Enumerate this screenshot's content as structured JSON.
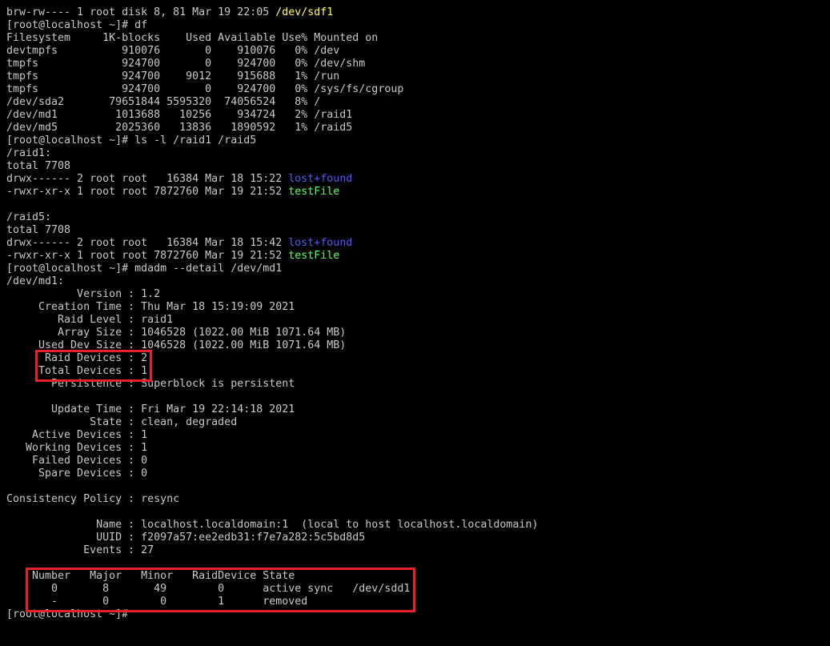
{
  "terminal": {
    "prompt": "[root@localhost ~]#",
    "lines": [
      {
        "text": "brw-rw---- 1 root disk 8, 81 Mar 19 22:05 ",
        "hl": "/dev/sdf1",
        "hl_color": "yellow"
      },
      {
        "text": "[root@localhost ~]# df"
      },
      {
        "text": "Filesystem     1K-blocks    Used Available Use% Mounted on"
      },
      {
        "text": "devtmpfs          910076       0    910076   0% /dev"
      },
      {
        "text": "tmpfs             924700       0    924700   0% /dev/shm"
      },
      {
        "text": "tmpfs             924700    9012    915688   1% /run"
      },
      {
        "text": "tmpfs             924700       0    924700   0% /sys/fs/cgroup"
      },
      {
        "text": "/dev/sda2       79651844 5595320  74056524   8% /"
      },
      {
        "text": "/dev/md1         1013688   10256    934724   2% /raid1"
      },
      {
        "text": "/dev/md5         2025360   13836   1890592   1% /raid5"
      },
      {
        "text": "[root@localhost ~]# ls -l /raid1 /raid5"
      },
      {
        "text": "/raid1:"
      },
      {
        "text": "total 7708"
      },
      {
        "text": "drwx------ 2 root root   16384 Mar 18 15:22 ",
        "hl": "lost+found",
        "hl_color": "blue"
      },
      {
        "text": "-rwxr-xr-x 1 root root 7872760 Mar 19 21:52 ",
        "hl": "testFile",
        "hl_color": "green"
      },
      {
        "text": ""
      },
      {
        "text": "/raid5:"
      },
      {
        "text": "total 7708"
      },
      {
        "text": "drwx------ 2 root root   16384 Mar 18 15:42 ",
        "hl": "lost+found",
        "hl_color": "blue"
      },
      {
        "text": "-rwxr-xr-x 1 root root 7872760 Mar 19 21:52 ",
        "hl": "testFile",
        "hl_color": "green"
      },
      {
        "text": "[root@localhost ~]# mdadm --detail /dev/md1"
      },
      {
        "text": "/dev/md1:"
      },
      {
        "text": "           Version : 1.2"
      },
      {
        "text": "     Creation Time : Thu Mar 18 15:19:09 2021"
      },
      {
        "text": "        Raid Level : raid1"
      },
      {
        "text": "        Array Size : 1046528 (1022.00 MiB 1071.64 MB)"
      },
      {
        "text": "     Used Dev Size : 1046528 (1022.00 MiB 1071.64 MB)"
      },
      {
        "text": "      Raid Devices : 2"
      },
      {
        "text": "     Total Devices : 1"
      },
      {
        "text": "       Persistence : Superblock is persistent"
      },
      {
        "text": ""
      },
      {
        "text": "       Update Time : Fri Mar 19 22:14:18 2021"
      },
      {
        "text": "             State : clean, degraded"
      },
      {
        "text": "    Active Devices : 1"
      },
      {
        "text": "   Working Devices : 1"
      },
      {
        "text": "    Failed Devices : 0"
      },
      {
        "text": "     Spare Devices : 0"
      },
      {
        "text": ""
      },
      {
        "text": "Consistency Policy : resync"
      },
      {
        "text": ""
      },
      {
        "text": "              Name : localhost.localdomain:1  (local to host localhost.localdomain)"
      },
      {
        "text": "              UUID : f2097a57:ee2edb31:f7e7a282:5c5bd8d5"
      },
      {
        "text": "            Events : 27"
      },
      {
        "text": ""
      },
      {
        "text": "    Number   Major   Minor   RaidDevice State"
      },
      {
        "text": "       0       8       49        0      active sync   /dev/sdd1"
      },
      {
        "text": "       -       0        0        1      removed"
      },
      {
        "text": "[root@localhost ~]#"
      }
    ]
  },
  "colors": {
    "background": "#000000",
    "foreground": "#c8c8c8",
    "yellow": "#ffff55",
    "blue": "#5555ff",
    "green": "#55ff55",
    "highlight_box": "#e8202a"
  }
}
